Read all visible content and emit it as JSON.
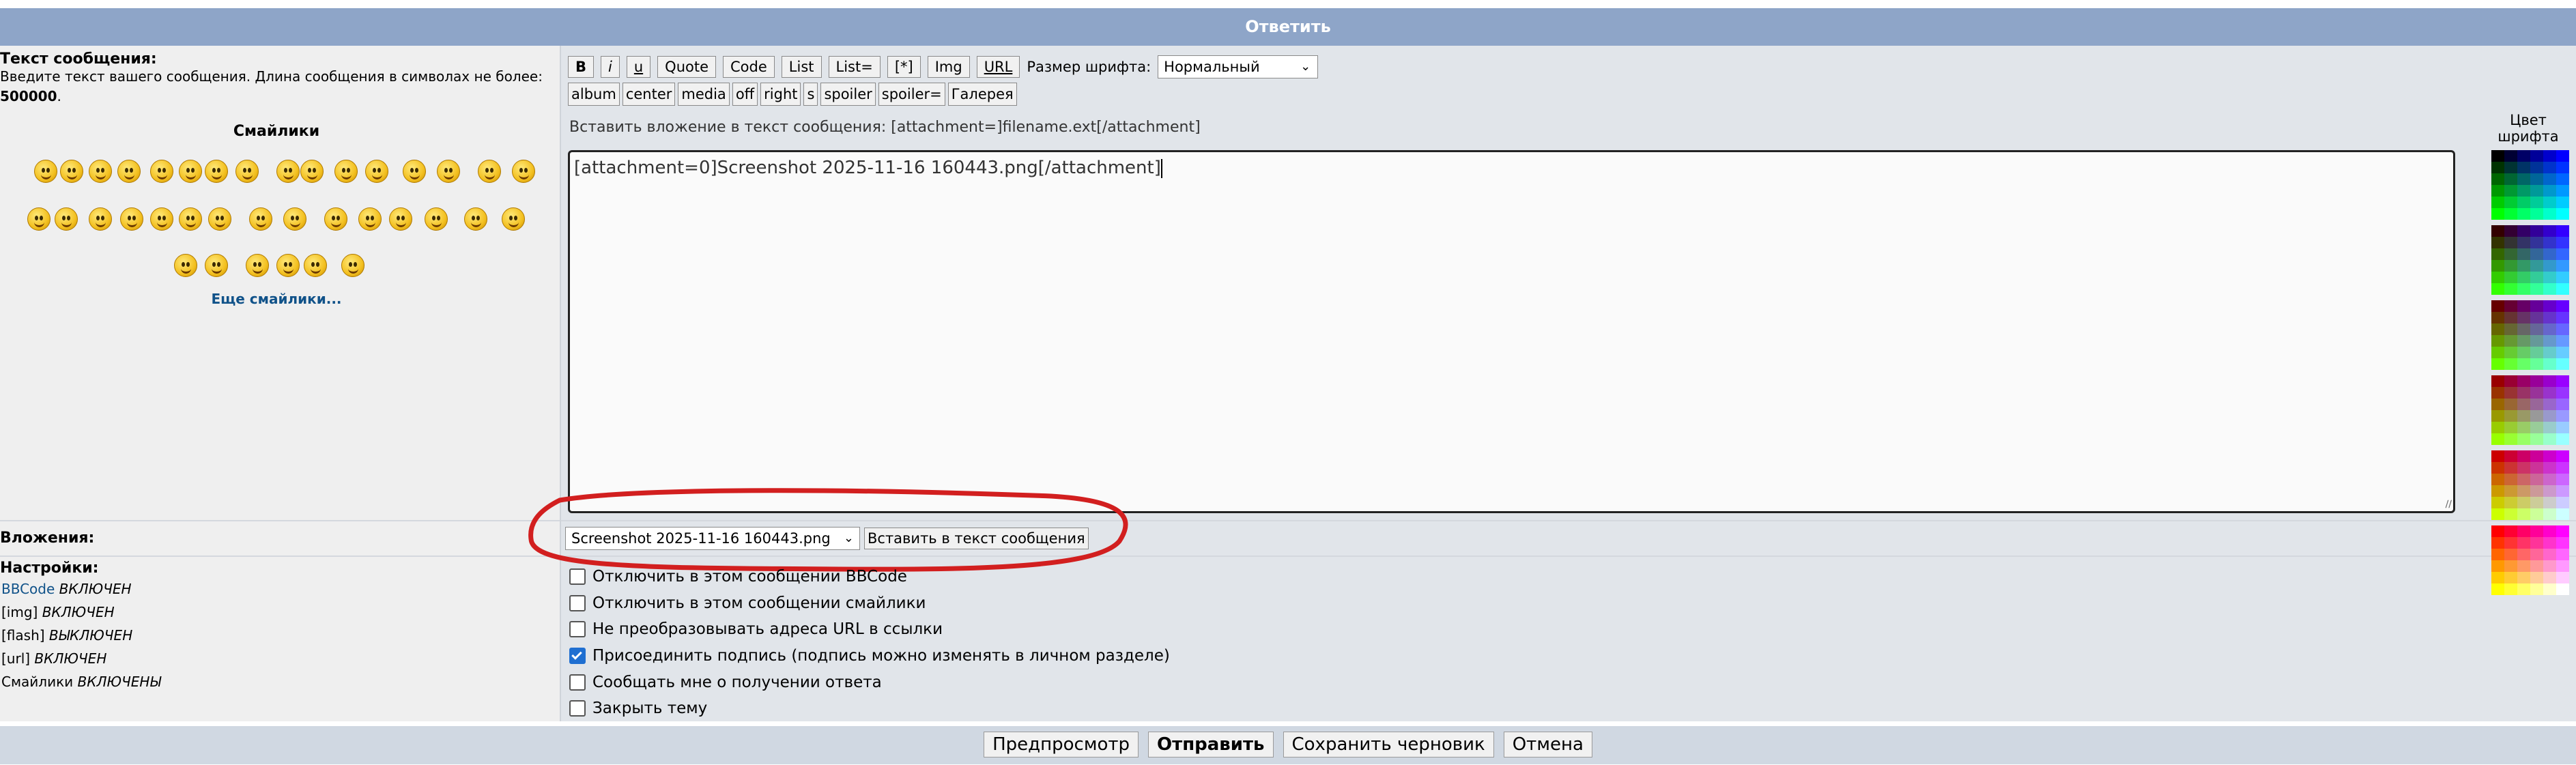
{
  "header": {
    "title": "Ответить"
  },
  "message_label": {
    "title": "Текст сообщения:",
    "description": "Введите текст вашего сообщения. Длина сообщения в символах не более:",
    "max_length": "500000",
    "dot": "."
  },
  "smilies": {
    "title": "Смайлики",
    "more_link": "Еще смайлики..."
  },
  "toolbar": {
    "row1": [
      "B",
      "i",
      "u",
      "Quote",
      "Code",
      "List",
      "List=",
      "[*]",
      "Img",
      "URL"
    ],
    "font_size_label": "Размер шрифта:",
    "font_size_value": "Нормальный",
    "row2": [
      "album",
      "center",
      "media",
      "off",
      "right",
      "s",
      "spoiler",
      "spoiler=",
      "Галерея"
    ]
  },
  "attachment_hint": "Вставить вложение в текст сообщения: [attachment=]filename.ext[/attachment]",
  "editor": {
    "value": "[attachment=0]Screenshot 2025-11-16 160443.png[/attachment]"
  },
  "color_panel": {
    "label_line1": "Цвет",
    "label_line2": "шрифта"
  },
  "attachments": {
    "label": "Вложения:",
    "selected_file": "Screenshot 2025-11-16 160443.png",
    "insert_button": "Вставить в текст сообщения"
  },
  "settings": {
    "title": "Настройки:",
    "items": [
      {
        "name": "BBCode",
        "status": "ВКЛЮЧЕН"
      },
      {
        "name": "[img]",
        "status": "ВКЛЮЧЕН"
      },
      {
        "name": "[flash]",
        "status": "ВЫКЛЮЧЕН"
      },
      {
        "name": "[url]",
        "status": "ВКЛЮЧЕН"
      },
      {
        "name": "Смайлики",
        "status": "ВКЛЮЧЕНЫ"
      }
    ]
  },
  "options": [
    {
      "label": "Отключить в этом сообщении BBCode",
      "checked": false
    },
    {
      "label": "Отключить в этом сообщении смайлики",
      "checked": false
    },
    {
      "label": "Не преобразовывать адреса URL в ссылки",
      "checked": false
    },
    {
      "label": "Присоединить подпись (подпись можно изменять в личном разделе)",
      "checked": true
    },
    {
      "label": "Сообщать мне о получении ответа",
      "checked": false
    },
    {
      "label": "Закрыть тему",
      "checked": false
    }
  ],
  "actions": {
    "preview": "Предпросмотр",
    "submit": "Отправить",
    "save_draft": "Сохранить черновик",
    "cancel": "Отмена"
  },
  "colors": {
    "header": "#8ea5c8",
    "annotation": "#d21f1f",
    "link": "#105289"
  }
}
